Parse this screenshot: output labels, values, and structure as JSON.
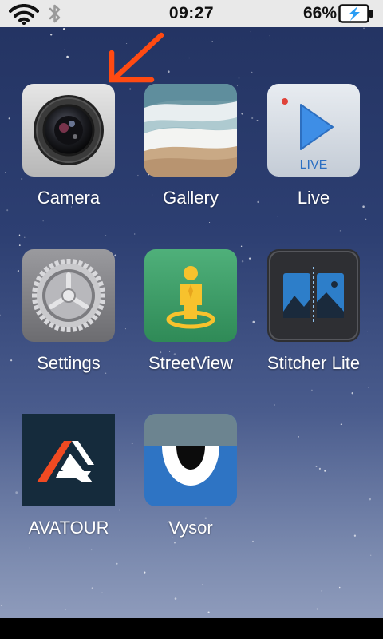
{
  "status_bar": {
    "time": "09:27",
    "battery_percent": "66%",
    "battery_level": 0.66,
    "charging": true,
    "wifi_icon": "wifi-icon",
    "bluetooth_icon": "bluetooth-icon"
  },
  "annotation": {
    "icon": "arrow-pointer-icon",
    "color": "#ff4a12"
  },
  "apps": [
    {
      "label": "Camera",
      "icon": "camera-lens-icon"
    },
    {
      "label": "Gallery",
      "icon": "beach-photo-icon"
    },
    {
      "label": "Live",
      "icon": "play-live-icon",
      "icon_text": "LIVE"
    },
    {
      "label": "Settings",
      "icon": "gear-icon"
    },
    {
      "label": "StreetView",
      "icon": "street-view-person-icon"
    },
    {
      "label": "Stitcher Lite",
      "icon": "stitch-panorama-icon"
    },
    {
      "label": "AVATOUR",
      "icon": "avatour-logo-icon"
    },
    {
      "label": "Vysor",
      "icon": "vysor-eye-icon"
    }
  ]
}
